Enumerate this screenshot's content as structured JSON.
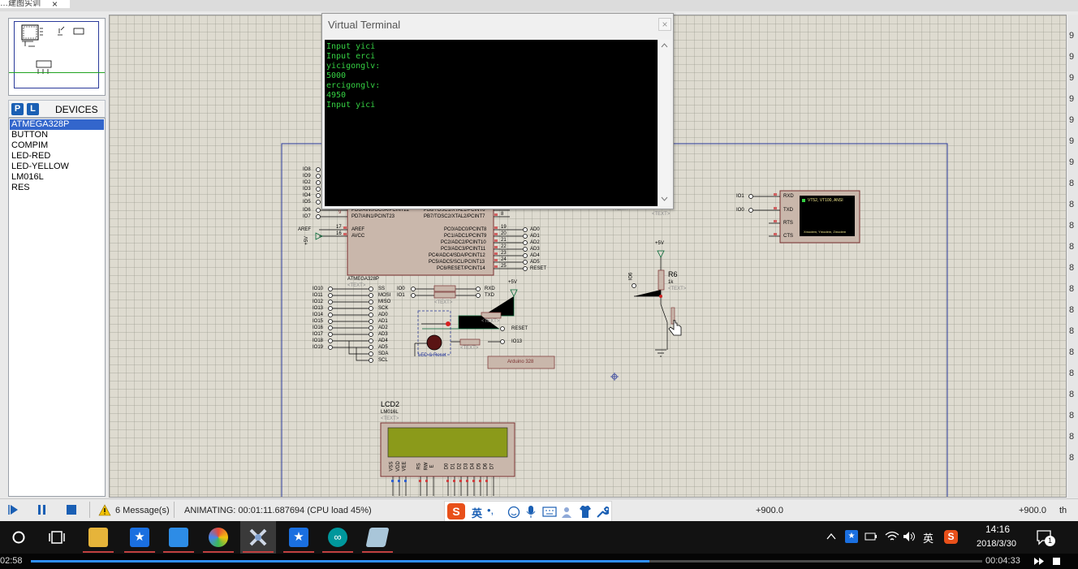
{
  "window": {
    "tab_text": "…建图实训",
    "tab_close": "×"
  },
  "left_panel": {
    "p_button": "P",
    "l_button": "L",
    "devices_title": "DEVICES",
    "devices": [
      "ATMEGA328P",
      "BUTTON",
      "COMPIM",
      "LED-RED",
      "LED-YELLOW",
      "LM016L",
      "RES"
    ],
    "selected_index": 0
  },
  "terminal": {
    "title": "Virtual Terminal",
    "close_label": "×",
    "lines": [
      "Input yici",
      "Input erci",
      "yicigonglv:",
      "5000",
      "ercigonglv:",
      "4950",
      "Input yici"
    ]
  },
  "schematic": {
    "mcu": {
      "name": "ATMEGA328P",
      "text": "<TEXT>",
      "left_io": [
        "IO8",
        "IO9",
        "IO2",
        "IO3",
        "IO4",
        "IO5",
        "IO6",
        "IO7"
      ],
      "left_pins": [
        "PD6/AIN0/OC0A/PCINT22",
        "PD7/AIN1/PCINT23",
        "AREF",
        "AVCC"
      ],
      "pin_numbers_left": [
        "9",
        "17",
        "16"
      ],
      "right_pins": [
        "PB6/TOSC1/XTAL1/PCINT6",
        "PB7/TOSC2/XTAL2/PCINT7",
        "PC0/ADC0/PCINT8",
        "PC1/ADC1/PCINT9",
        "PC2/ADC2/PCINT10",
        "PC3/ADC3/PCINT11",
        "PC4/ADC4/SDA/PCINT12",
        "PC5/ADC5/SCL/PCINT13",
        "PC6/RESET/PCINT14"
      ],
      "pin_numbers_right": [
        "8",
        "19",
        "20",
        "21",
        "22",
        "23",
        "24",
        "25"
      ],
      "right_io": [
        "AD0",
        "AD1",
        "AD2",
        "AD3",
        "AD4",
        "AD5",
        "RESET"
      ],
      "aref_label": "AREF",
      "aref_power": "+5V"
    },
    "header_labels": [
      "IO10",
      "IO11",
      "IO12",
      "IO13",
      "IO14",
      "IO15",
      "IO16",
      "IO17",
      "IO18",
      "IO19"
    ],
    "header_signals": [
      "SS",
      "MOSI",
      "MISO",
      "SCK",
      "AD0",
      "AD1",
      "AD2",
      "AD3",
      "AD4",
      "AD5",
      "SDA",
      "SCL"
    ],
    "serial": {
      "left": [
        "IO0",
        "IO1"
      ],
      "right": [
        "RXD",
        "TXD"
      ],
      "text": "<TEXT>"
    },
    "power_5v": "+5V",
    "reset_label": "RESET",
    "io13_label": "IO13",
    "led_reset_label": "LED & Reset",
    "arduino_label": "Arduino 328",
    "text_placeholder": "<TEXT>",
    "vt_block": {
      "pins": [
        "RXD",
        "TXD",
        "RTS",
        "CTS"
      ],
      "left_io": [
        "IO1",
        "IO0"
      ],
      "screen_title": "VT52, VT100, ANSI",
      "screen_footer": "Xmodem, Ymodem, Zmodem"
    },
    "r6": {
      "name": "R6",
      "value": "1k",
      "power": "+5V",
      "io": "IO6",
      "text": "<TEXT>"
    },
    "lcd": {
      "name": "LCD2",
      "model": "LM016L",
      "text": "<TEXT>",
      "pins": [
        "VSS",
        "VDD",
        "VEE",
        "RS",
        "RW",
        "E",
        "D0",
        "D1",
        "D2",
        "D3",
        "D4",
        "D5",
        "D6",
        "D7"
      ]
    },
    "small_labels": {
      "led_pin": "LED2",
      "text_small": "<TEXT>"
    }
  },
  "status_bar": {
    "messages": "6 Message(s)",
    "animating": "ANIMATING: 00:01:11.687694 (CPU load 45%)",
    "coord_x": "+900.0",
    "coord_y": "+900.0",
    "unit": "th"
  },
  "ime": {
    "lang": "英"
  },
  "taskbar": {
    "time": "14:16",
    "date": "2018/3/30",
    "tray_lang": "英",
    "notification_count": "1"
  },
  "video": {
    "elapsed": "02:58",
    "total": "00:04:33",
    "progress": 0.65
  },
  "right_ruler": [
    "9",
    "9",
    "9",
    "9",
    "9",
    "9",
    "9",
    "8",
    "8",
    "8",
    "8",
    "8",
    "8",
    "8",
    "8",
    "8",
    "8",
    "8",
    "8",
    "8",
    "8"
  ],
  "colors": {
    "terminal_text": "#35d043",
    "schematic_blue": "#2a3a9a",
    "component_red": "#cc2222",
    "selection": "#3366cc"
  }
}
